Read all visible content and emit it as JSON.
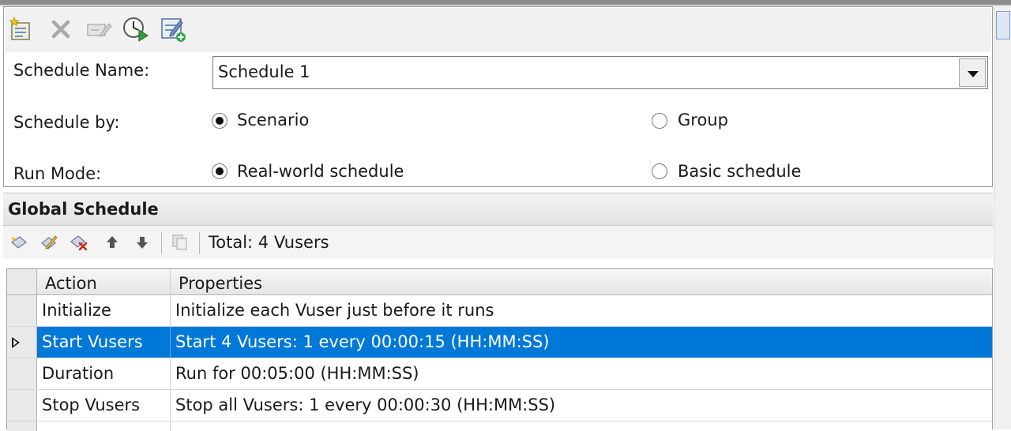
{
  "toolbar": {
    "icons": [
      "new-schedule-icon",
      "delete-icon",
      "rename-icon",
      "start-time-icon",
      "edit-schedule-icon"
    ]
  },
  "schedule": {
    "name_label": "Schedule Name:",
    "name_value": "Schedule 1",
    "by_label": "Schedule by:",
    "by_options": [
      {
        "label": "Scenario",
        "checked": true
      },
      {
        "label": "Group",
        "checked": false
      }
    ],
    "run_mode_label": "Run Mode:",
    "run_mode_options": [
      {
        "label": "Real-world schedule",
        "checked": true
      },
      {
        "label": "Basic schedule",
        "checked": false
      }
    ]
  },
  "global_schedule": {
    "title": "Global Schedule",
    "toolbar_icons": [
      "add-action-icon",
      "edit-action-icon",
      "delete-action-icon",
      "move-up-icon",
      "move-down-icon",
      "copy-icon"
    ],
    "total": "Total: 4 Vusers",
    "columns": [
      "Action",
      "Properties"
    ],
    "rows": [
      {
        "action": "Initialize",
        "properties": "Initialize each Vuser just before it runs",
        "selected": false
      },
      {
        "action": "Start  Vusers",
        "properties": "Start 4 Vusers: 1 every 00:00:15 (HH:MM:SS)",
        "selected": true
      },
      {
        "action": "Duration",
        "properties": "Run for 00:05:00 (HH:MM:SS)",
        "selected": false
      },
      {
        "action": "Stop Vusers",
        "properties": "Stop all Vusers: 1 every 00:00:30 (HH:MM:SS)",
        "selected": false
      }
    ]
  },
  "colors": {
    "selection": "#0078d7",
    "toolbar_bg": "#f1f1f1"
  }
}
